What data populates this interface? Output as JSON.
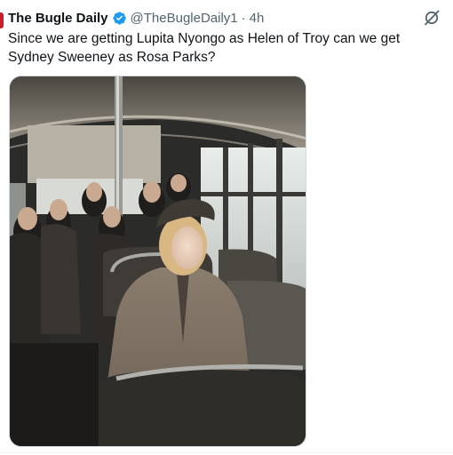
{
  "tweet": {
    "author_name": "The Bugle Daily",
    "handle": "@TheBugleDaily1",
    "separator": "·",
    "time": "4h",
    "text": "Since we are getting Lupita Nyongo as Helen of Troy can we get Sydney Sweeney as Rosa Parks?",
    "media": {
      "description_icon": "photo"
    }
  },
  "colors": {
    "verified": "#1d9bf0",
    "secondary_text": "#536471",
    "primary_text": "#0f1419"
  },
  "icons": {
    "verified": "verified-badge-icon",
    "grok": "grok-icon"
  }
}
